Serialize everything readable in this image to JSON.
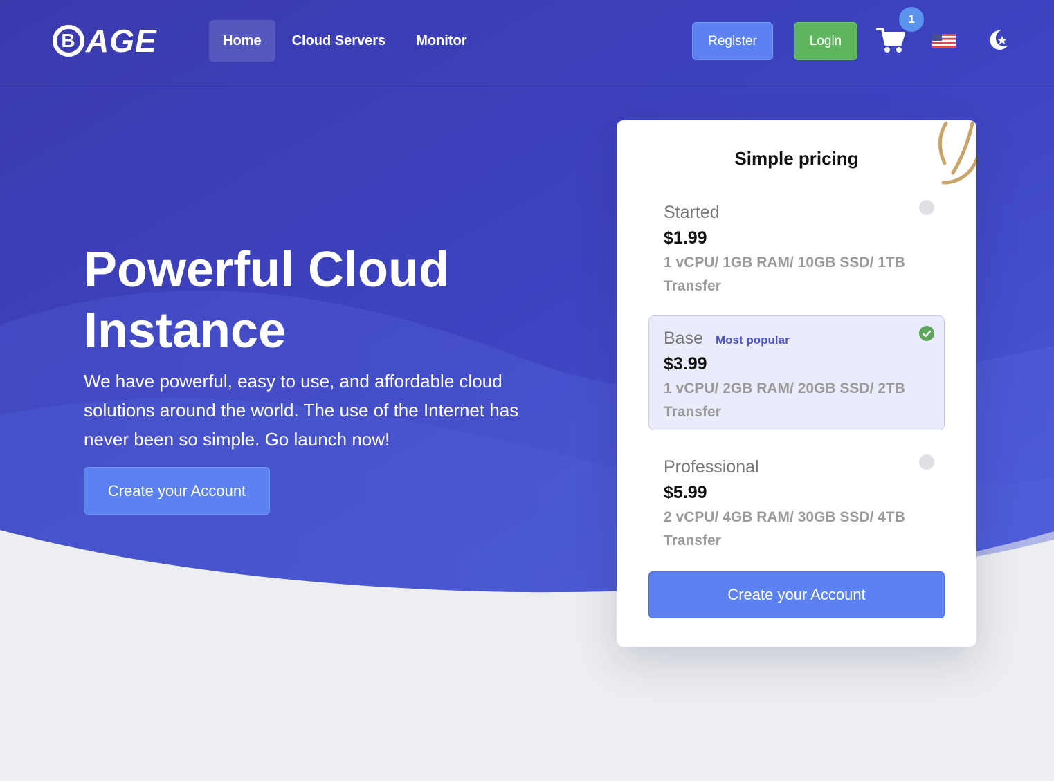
{
  "brand": {
    "logo_mark": "B",
    "logo_text": "AGE"
  },
  "nav": {
    "links": [
      {
        "label": "Home",
        "active": true
      },
      {
        "label": "Cloud Servers",
        "active": false
      },
      {
        "label": "Monitor",
        "active": false
      }
    ],
    "register_label": "Register",
    "login_label": "Login",
    "cart_count": "1",
    "cart_icon": "shopping-cart-icon",
    "language_icon": "us-flag-icon",
    "theme_icon": "moon-star-icon"
  },
  "hero": {
    "title_line1": "Powerful Cloud",
    "title_line2": "Instance",
    "description": "We have powerful, easy to use, and affordable cloud solutions around the world. The use of the Internet has never been so simple. Go launch now!",
    "cta_label": "Create your Account"
  },
  "pricing": {
    "title": "Simple pricing",
    "plans": [
      {
        "name": "Started",
        "price": "$1.99",
        "specs": "1 vCPU/ 1GB RAM/ 10GB SSD/ 1TB Transfer",
        "badge": "",
        "selected": false
      },
      {
        "name": "Base",
        "price": "$3.99",
        "specs": "1 vCPU/ 2GB RAM/ 20GB SSD/ 2TB Transfer",
        "badge": "Most popular",
        "selected": true
      },
      {
        "name": "Professional",
        "price": "$5.99",
        "specs": "2 vCPU/ 4GB RAM/ 30GB SSD/ 4TB Transfer",
        "badge": "",
        "selected": false
      }
    ],
    "cta_label": "Create your Account"
  },
  "colors": {
    "hero_start": "#3d3fb6",
    "hero_end": "#4a56d8",
    "accent_button": "#5b82f0",
    "login_button": "#5fb55e",
    "selected_plan_bg": "#ebecfb",
    "popular_text": "#4b55c8",
    "check_green": "#5fa65d"
  }
}
